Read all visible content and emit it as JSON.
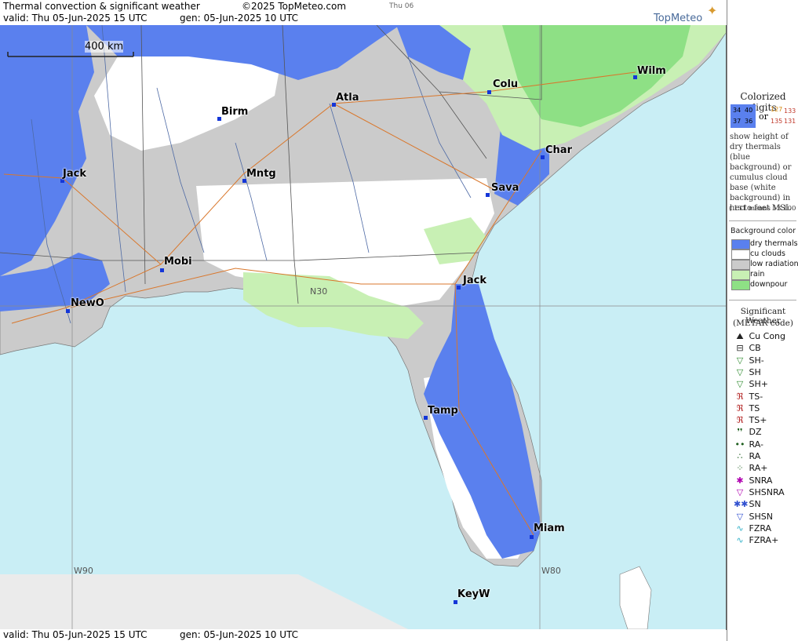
{
  "header": {
    "title": "Thermal convection & significant weather",
    "copyright": "©2025 TopMeteo.com",
    "day_tab": "Thu 06",
    "valid": "valid:  Thu  05-Jun-2025  15 UTC",
    "gen": "gen: 05-Jun-2025 10 UTC",
    "logo_text": "TopMeteo"
  },
  "footer": {
    "valid": "valid:  Thu  05-Jun-2025  15 UTC",
    "gen": "gen: 05-Jun-2025 10 UTC"
  },
  "map": {
    "scale_label": "400 km",
    "meridians": [
      "W90",
      "W80"
    ],
    "parallel": "N30",
    "cities": [
      "Wilm",
      "Colu",
      "Atla",
      "Birm",
      "Char",
      "Jack",
      "Mntg",
      "Sava",
      "Mobi",
      "Jack",
      "NewO",
      "Tamp",
      "Miam",
      "KeyW"
    ],
    "colors": {
      "sea": "#c9eef5",
      "land_gray": "#cbcbcb",
      "dry": "#5a80ee",
      "rain": "#c8f0b4",
      "downpour": "#8ee085",
      "cu": "#ffffff"
    }
  },
  "legend": {
    "colorized_title": "Colorized digits",
    "sample_blue": [
      "34",
      "40",
      "37",
      "36"
    ],
    "or": "or",
    "sample_white": [
      "127",
      "133",
      "135",
      "131"
    ],
    "desc": "show height of dry thermals (blue background) or cumulus cloud base (white background) in hecto feet MSL",
    "desc_note": "( 131 means 13.100 ft)",
    "bg_title": "Background color",
    "bg_items": [
      {
        "label": "dry thermals",
        "color": "#5a80ee"
      },
      {
        "label": "cu clouds",
        "color": "#ffffff"
      },
      {
        "label": "low radiation",
        "color": "#cbcbcb"
      },
      {
        "label": "rain",
        "color": "#c8f0b4"
      },
      {
        "label": "downpour",
        "color": "#8ee085"
      }
    ],
    "sig_title": "Significant Weather",
    "sig_sub": "(METAR code)",
    "sig_items": [
      {
        "label": "Cu Cong",
        "icon": "cu-cong-icon",
        "glyph": "⛰"
      },
      {
        "label": "CB",
        "icon": "cb-icon",
        "glyph": "⊟"
      },
      {
        "label": "SH-",
        "icon": "shower-light-icon",
        "glyph": "▽"
      },
      {
        "label": "SH",
        "icon": "shower-icon",
        "glyph": "▽"
      },
      {
        "label": "SH+",
        "icon": "shower-heavy-icon",
        "glyph": "▽"
      },
      {
        "label": "TS-",
        "icon": "thunder-light-icon",
        "glyph": "ℜ"
      },
      {
        "label": "TS",
        "icon": "thunder-icon",
        "glyph": "ℜ"
      },
      {
        "label": "TS+",
        "icon": "thunder-heavy-icon",
        "glyph": "ℜ"
      },
      {
        "label": "DZ",
        "icon": "drizzle-icon",
        "glyph": "❜❜"
      },
      {
        "label": "RA-",
        "icon": "rain-light-icon",
        "glyph": "••"
      },
      {
        "label": "RA",
        "icon": "rain-icon",
        "glyph": "∴"
      },
      {
        "label": "RA+",
        "icon": "rain-heavy-icon",
        "glyph": "⁘"
      },
      {
        "label": "SNRA",
        "icon": "snow-rain-icon",
        "glyph": "✱"
      },
      {
        "label": "SHSNRA",
        "icon": "snow-rain-shower-icon",
        "glyph": "▽"
      },
      {
        "label": "SN",
        "icon": "snow-icon",
        "glyph": "✱✱"
      },
      {
        "label": "SHSN",
        "icon": "snow-shower-icon",
        "glyph": "▽"
      },
      {
        "label": "FZRA",
        "icon": "freezing-rain-icon",
        "glyph": "∿"
      },
      {
        "label": "FZRA+",
        "icon": "freezing-rain-heavy-icon",
        "glyph": "∿"
      }
    ]
  }
}
